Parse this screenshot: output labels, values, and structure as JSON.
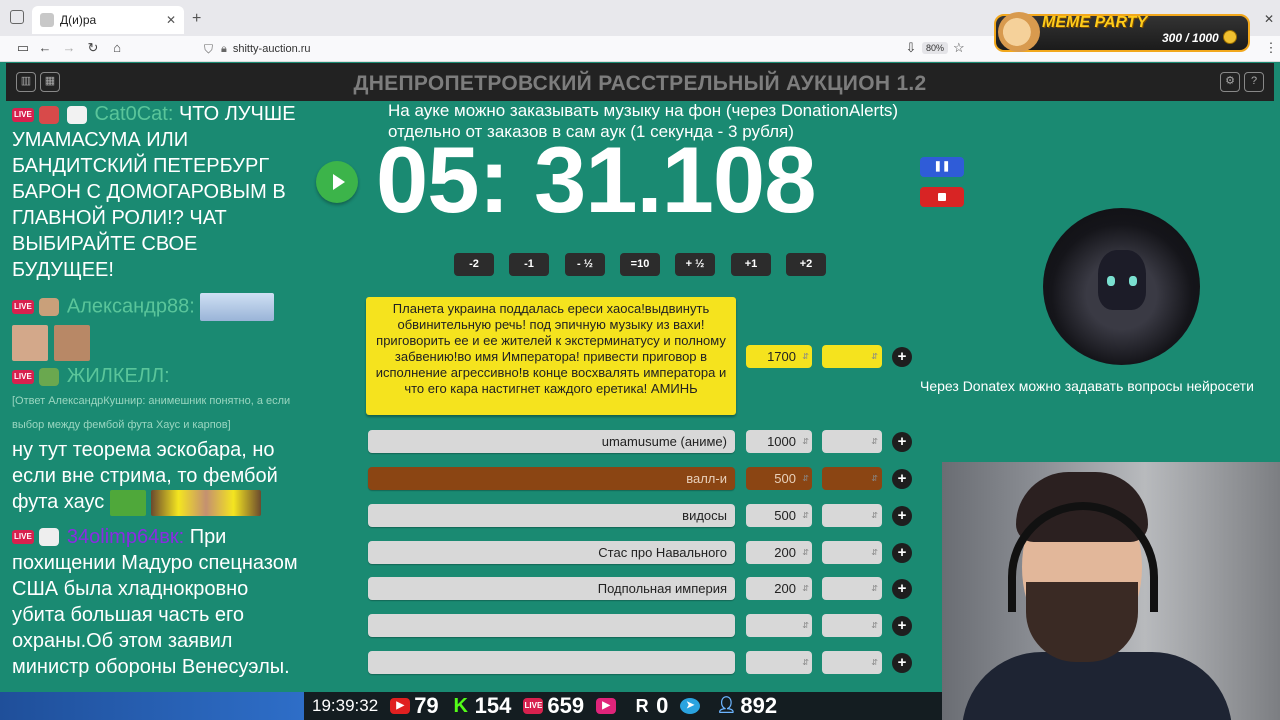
{
  "browser": {
    "tab_title": "Д(и)ра",
    "url": "shitty-auction.ru",
    "zoom": "80%"
  },
  "meme_party": {
    "title": "MEME PARTY",
    "count": "300 / 1000"
  },
  "app": {
    "title": "ДНЕПРОПЕТРОВСКИЙ РАССТРЕЛЬНЫЙ АУКЦИОН 1.2"
  },
  "chat": {
    "messages": [
      {
        "nick": "Cat0Cat:",
        "text": "ЧТО ЛУЧШЕ УМАМАСУМА ИЛИ БАНДИТСКИЙ ПЕТЕРБУРГ БАРОН С ДОМОГАРОВЫМ В ГЛАВНОЙ РОЛИ!? ЧАТ ВЫБИРАЙТЕ СВОЕ БУДУЩЕЕ!",
        "nick_color": "#5ac59a"
      },
      {
        "nick": "Александр88:",
        "text": "",
        "nick_color": "#5ac59a"
      },
      {
        "nick": "ЖИЛКЕЛЛ:",
        "reply": "[Ответ АлександрКушнир: анимешник понятно, а если выбор между фембой фута Хаус и карпов]",
        "text": "ну тут теорема эскобара, но если вне стрима, то фембой фута хаус",
        "nick_color": "#5ac59a"
      },
      {
        "nick": "34olimp64вк:",
        "text": "При похищении Мадуро спецназом США была хладнокровно убита большая часть его охраны.Об этом заявил министр обороны Венесуэлы.",
        "nick_color": "#8a2be2"
      }
    ]
  },
  "timer": {
    "notice": "На ауке можно заказывать музыку на фон (через DonationAlerts) отдельно от заказов в сам аук (1 секунда - 3 рубля)",
    "value": "05: 31.108",
    "adjust_buttons": [
      "-2",
      "-1",
      "- ½",
      "=10",
      "+ ½",
      "+1",
      "+2"
    ]
  },
  "lots": {
    "top": {
      "text": "Планета украина поддалась ереси хаоса!выдвинуть обвинительную речь! под эпичную музыку из вахи! приговорить ее и ее жителей к экстерминатусу и полному забвению!во имя Императора! привести приговор в исполнение агрессивно!в конце восхвалять императора и что его кара настигнет каждого еретика! АМИНЬ",
      "amount": "1700"
    },
    "items": [
      {
        "name": "umamusume (аниме)",
        "amount": "1000"
      },
      {
        "name": "валл-и",
        "amount": "500"
      },
      {
        "name": "видосы",
        "amount": "500"
      },
      {
        "name": "Стас про Навального",
        "amount": "200"
      },
      {
        "name": "Подпольная империя",
        "amount": "200"
      },
      {
        "name": "",
        "amount": ""
      },
      {
        "name": "",
        "amount": ""
      }
    ]
  },
  "side": {
    "donatex_note": "Через Donatex можно задавать вопросы нейросети"
  },
  "stats": {
    "clock": "19:39:32",
    "youtube": "79",
    "kick": "154",
    "vk_live": "659",
    "rutube": "",
    "r": "0",
    "telegram": "",
    "viewers": "892"
  }
}
